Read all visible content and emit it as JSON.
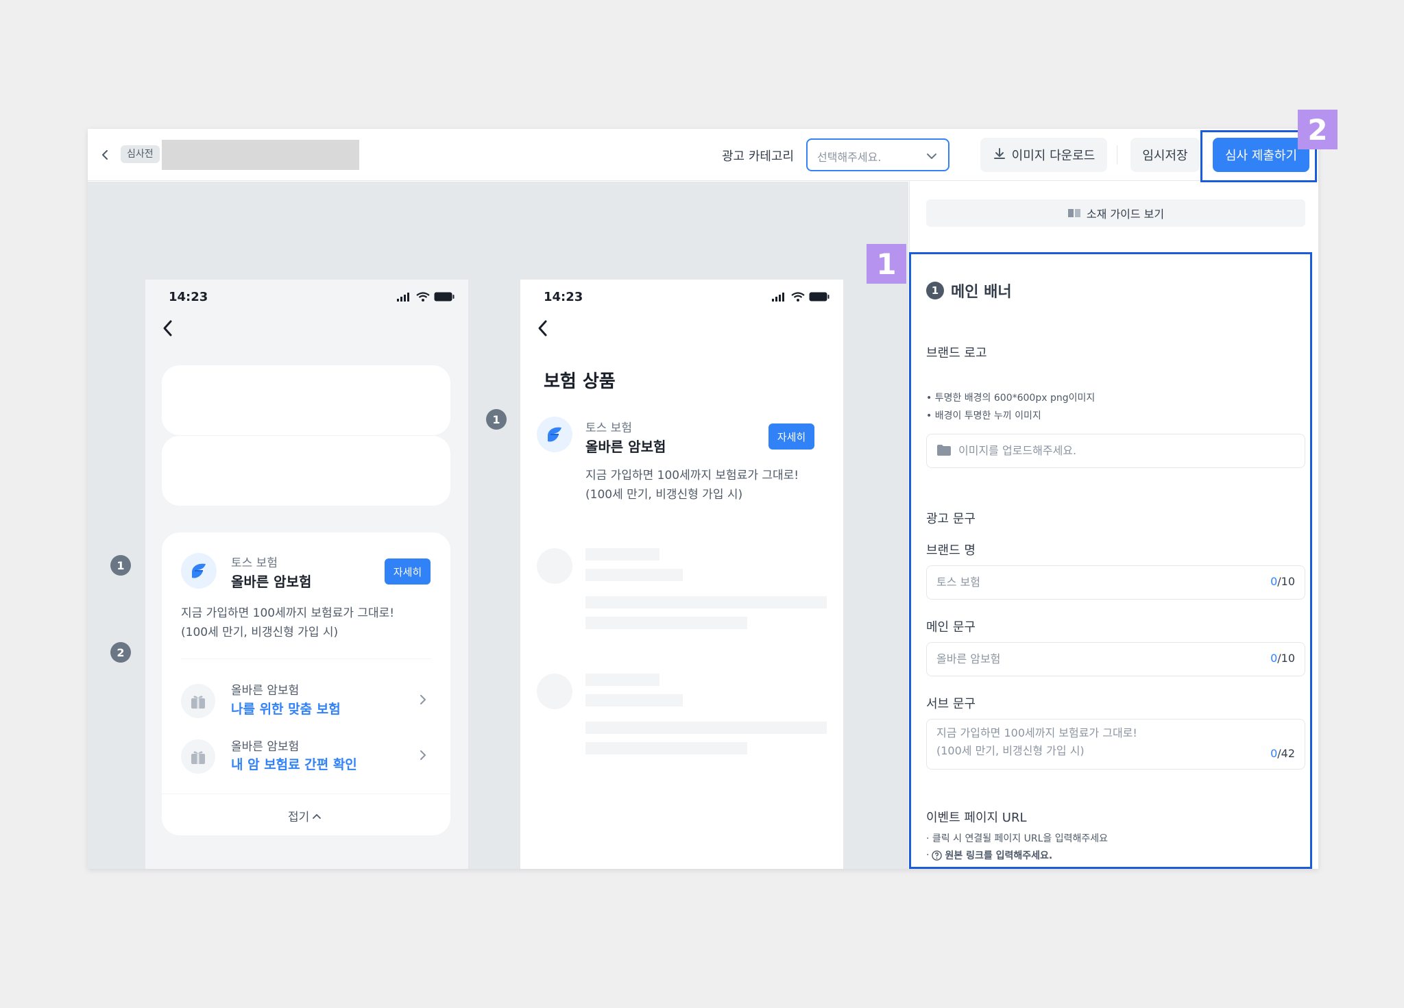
{
  "header": {
    "status_badge": "심사전",
    "category_label": "광고 카테고리",
    "category_placeholder": "선택해주세요.",
    "download_label": "이미지 다운로드",
    "save_label": "임시저장",
    "submit_label": "심사 제출하기"
  },
  "phone1": {
    "time": "14:23",
    "brand": "토스 보험",
    "main": "올바른 암보험",
    "detail_label": "자세히",
    "sub_line1": "지금 가입하면 100세까지 보험료가 그대로!",
    "sub_line2": "(100세 만기, 비갱신형 가입 시)",
    "rows": [
      {
        "title": "올바른 암보험",
        "link": "나를 위한 맞춤 보험"
      },
      {
        "title": "올바른 암보험",
        "link": "내 암 보험료 간편 확인"
      }
    ],
    "fold_label": "접기",
    "markers": [
      "1",
      "2"
    ]
  },
  "phone2": {
    "time": "14:23",
    "title": "보험 상품",
    "brand": "토스 보험",
    "main": "올바른 암보험",
    "detail_label": "자세히",
    "sub_line1": "지금 가입하면 100세까지 보험료가 그대로!",
    "sub_line2": "(100세 만기, 비갱신형 가입 시)",
    "marker": "1"
  },
  "panel": {
    "guide_label": "소재 가이드 보기",
    "section_num": "1",
    "section_title": "메인 배너",
    "brand_logo_label": "브랜드 로고",
    "logo_hint1": "• 투명한 배경의 600*600px png이미지",
    "logo_hint2": "• 배경이 투명한 누끼 이미지",
    "upload_placeholder": "이미지를 업로드해주세요.",
    "ad_copy_label": "광고 문구",
    "brand_name_label": "브랜드 명",
    "brand_name_placeholder": "토스 보험",
    "brand_name_count": "0",
    "brand_name_max": "/10",
    "main_copy_label": "메인 문구",
    "main_copy_placeholder": "올바른 암보험",
    "main_copy_count": "0",
    "main_copy_max": "/10",
    "sub_copy_label": "서브 문구",
    "sub_copy_placeholder1": "지금 가입하면 100세까지 보험료가 그대로!",
    "sub_copy_placeholder2": "(100세 만기, 비갱신형 가입 시)",
    "sub_copy_count": "0",
    "sub_copy_max": "/42",
    "event_url_label": "이벤트 페이지 URL",
    "event_hint1": "· 클릭 시 연결될 페이지 URL을 입력해주세요",
    "event_hint2": "원본 링크를 입력해주세요."
  },
  "annotations": {
    "tag1": "1",
    "tag2": "2"
  },
  "colors": {
    "accent": "#3182f6",
    "highlight_border": "#1a5cdc",
    "highlight_tag": "#b793f0"
  }
}
